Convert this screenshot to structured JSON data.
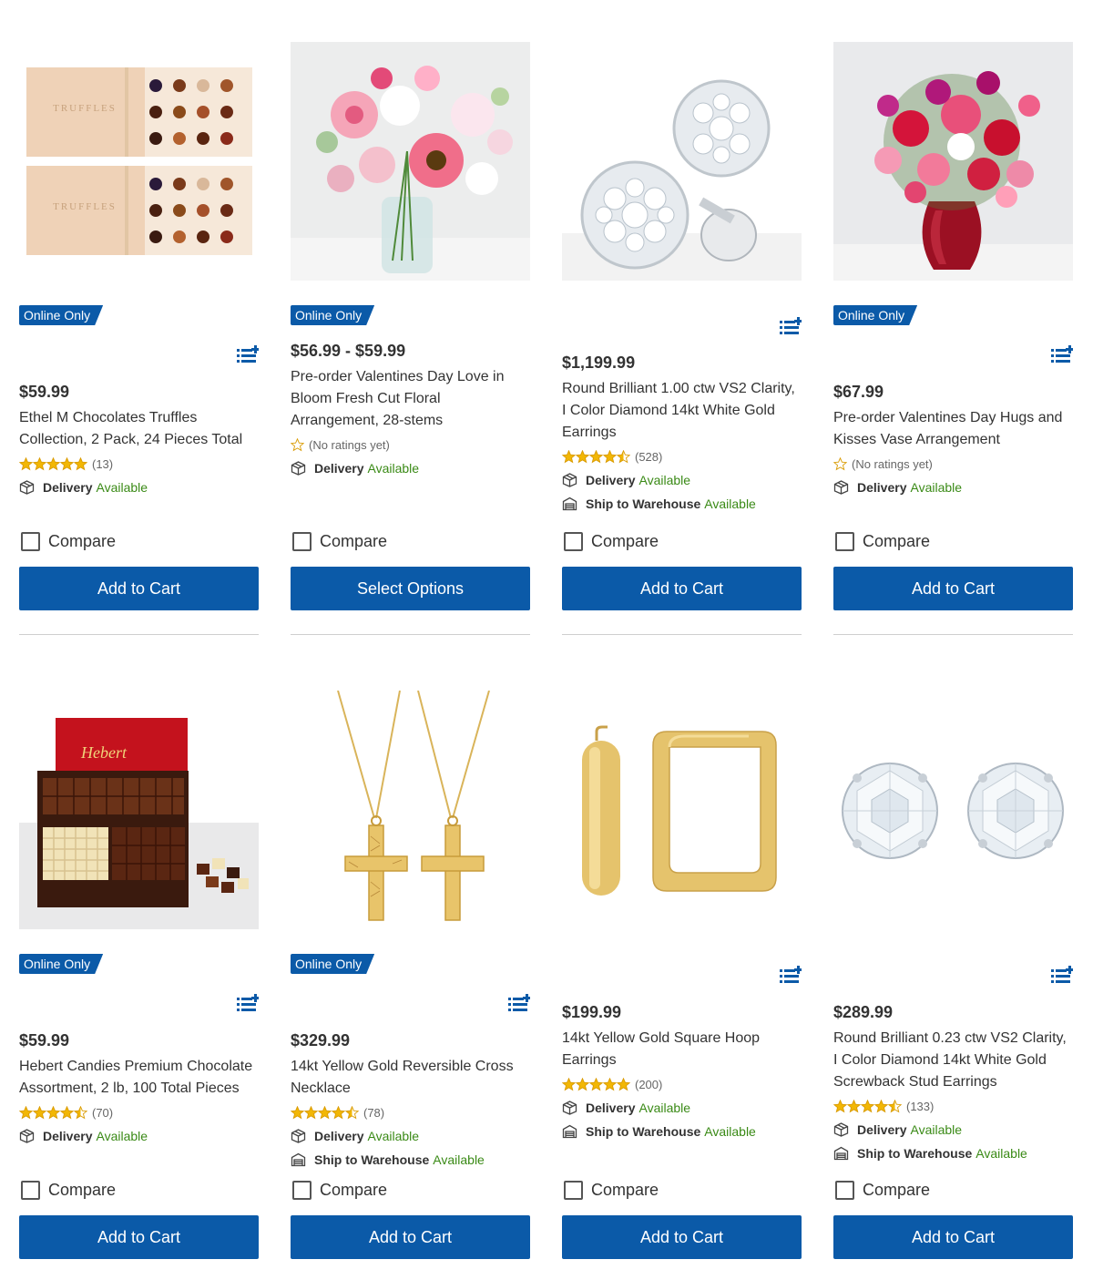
{
  "common": {
    "online_only": "Online Only",
    "compare_label": "Compare",
    "delivery_label": "Delivery",
    "warehouse_label": "Ship to Warehouse",
    "available": "Available",
    "accent_color": "#0b5aa8",
    "available_color": "#3a8a16",
    "star_color": "#f2b705"
  },
  "products": [
    {
      "price": "$59.99",
      "title": "Ethel M Chocolates Truffles Collection, 2 Pack, 24 Pieces Total",
      "rating": 5,
      "review_count": "(13)",
      "cta": "Add to Cart",
      "image": "truffles-box"
    },
    {
      "price": "$56.99 - $59.99",
      "title": "Pre-order Valentines Day Love in Bloom Fresh Cut Floral Arrangement, 28-stems",
      "rating": 0,
      "review_count": "(No ratings yet)",
      "cta": "Select Options",
      "image": "flower-bouquet"
    },
    {
      "price": "$1,199.99",
      "title": "Round Brilliant 1.00 ctw VS2 Clarity, I Color Diamond 14kt White Gold Earrings",
      "rating": 4.5,
      "review_count": "(528)",
      "cta": "Add to Cart",
      "image": "diamond-cluster-earrings"
    },
    {
      "price": "$67.99",
      "title": "Pre-order Valentines Day Hugs and Kisses Vase Arrangement",
      "rating": 0,
      "review_count": "(No ratings yet)",
      "cta": "Add to Cart",
      "image": "red-vase-bouquet"
    },
    {
      "price": "$59.99",
      "title": "Hebert Candies Premium Chocolate Assortment, 2 lb, 100 Total Pieces",
      "rating": 4.5,
      "review_count": "(70)",
      "cta": "Add to Cart",
      "image": "chocolate-assortment-box"
    },
    {
      "price": "$329.99",
      "title": "14kt Yellow Gold Reversible Cross Necklace",
      "rating": 4.5,
      "review_count": "(78)",
      "cta": "Add to Cart",
      "image": "gold-cross-necklace"
    },
    {
      "price": "$199.99",
      "title": "14kt Yellow Gold Square Hoop Earrings",
      "rating": 5,
      "review_count": "(200)",
      "cta": "Add to Cart",
      "image": "gold-hoop-earrings"
    },
    {
      "price": "$289.99",
      "title": "Round Brilliant 0.23 ctw VS2 Clarity, I Color Diamond 14kt White Gold Screwback Stud Earrings",
      "rating": 4.5,
      "review_count": "(133)",
      "cta": "Add to Cart",
      "image": "diamond-stud-earrings"
    }
  ]
}
